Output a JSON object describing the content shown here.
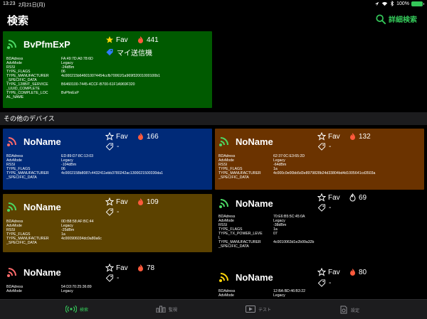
{
  "status": {
    "time": "13:23",
    "date": "2月21日(月)",
    "battery": "100%"
  },
  "nav": {
    "title": "検索",
    "detail": "詳細検索"
  },
  "colors": {
    "accent": "#34c759",
    "green_card": "#005a00",
    "blue_card": "#002a78",
    "brown_card": "#6b3300",
    "olive_card": "#5c4200"
  },
  "featured": {
    "name": "BvPfmExP",
    "fav_label": "Fav",
    "count": "441",
    "tag": "マイ送信機",
    "props": [
      {
        "k": "BDAdress",
        "v": "FA:49:7D:A0:78:6D"
      },
      {
        "k": "AdvMode",
        "v": "Legacy"
      },
      {
        "k": "RSSI",
        "v": "-24dBm"
      },
      {
        "k": "TYPE_FLAGS",
        "v": "06"
      },
      {
        "k": "TYPE_MANUFACTURER",
        "v": "4c000215b646010074454ccfb70061f1a969f32001000100b1"
      },
      {
        "k": "_SPECIFIC_DATA",
        "v": ""
      },
      {
        "k": "TYPE_128BIT_SERVICE",
        "v": "B6460100-7445-4CCF-B700-61F1A969F320"
      },
      {
        "k": "_UUID_COMPLETE",
        "v": ""
      },
      {
        "k": "TYPE_COMPLETE_LOC",
        "v": "BvPfmExP"
      },
      {
        "k": "AL_NAME",
        "v": ""
      }
    ]
  },
  "section_label": "その他のデバイス",
  "devices": [
    {
      "name": "NoName",
      "fav_label": "Fav",
      "count": "166",
      "tag": "-",
      "props": [
        {
          "k": "BDAdress",
          "v": "ED:89:D7:8C:13:03"
        },
        {
          "k": "AdvMode",
          "v": "Legacy"
        },
        {
          "k": "RSSI",
          "v": "-104dBm"
        },
        {
          "k": "TYPE_FLAGS",
          "v": "06"
        },
        {
          "k": "TYPE_MANUFACTURER",
          "v": "4c0002158b8087c4432411ebb3780242ac1300021500330da1"
        },
        {
          "k": "_SPECIFIC_DATA",
          "v": ""
        }
      ]
    },
    {
      "name": "NoName",
      "fav_label": "Fav",
      "count": "132",
      "tag": "-",
      "props": [
        {
          "k": "BDAdress",
          "v": "62:37:0C:E3:65:2D"
        },
        {
          "k": "AdvMode",
          "v": "Legacy"
        },
        {
          "k": "RSSI",
          "v": "-64dBm"
        },
        {
          "k": "TYPE_FLAGS",
          "v": "1a"
        },
        {
          "k": "TYPE_MANUFACTURER",
          "v": "4c000c0e00bb5d3e8979828b24d33804bd4d1005641cd3503a"
        },
        {
          "k": "_SPECIFIC_DATA",
          "v": ""
        }
      ]
    },
    {
      "name": "NoName",
      "fav_label": "Fav",
      "count": "109",
      "tag": "-",
      "props": [
        {
          "k": "BDAdress",
          "v": "0D:B8:58:AF:BC:44"
        },
        {
          "k": "AdvMode",
          "v": "Legacy"
        },
        {
          "k": "RSSI",
          "v": "-25dBm"
        },
        {
          "k": "TYPE_FLAGS",
          "v": "1a"
        },
        {
          "k": "TYPE_MANUFACTURER",
          "v": "4c000906034dc0a80a6c"
        },
        {
          "k": "_SPECIFIC_DATA",
          "v": ""
        }
      ]
    },
    {
      "name": "NoName",
      "fav_label": "Fav",
      "count": "69",
      "tag": "-",
      "props": [
        {
          "k": "BDAdress",
          "v": "70:E6:B5:5C:45:0A"
        },
        {
          "k": "AdvMode",
          "v": "Legacy"
        },
        {
          "k": "RSSI",
          "v": "-38dBm"
        },
        {
          "k": "TYPE_FLAGS",
          "v": "1a"
        },
        {
          "k": "TYPE_TX_POWER_LEVE",
          "v": "07"
        },
        {
          "k": "L",
          "v": ""
        },
        {
          "k": "TYPE_MANUFACTURER",
          "v": "4c0010063d1e2b99a32b"
        },
        {
          "k": "_SPECIFIC_DATA",
          "v": ""
        }
      ]
    },
    {
      "name": "NoName",
      "fav_label": "Fav",
      "count": "78",
      "tag": "-",
      "props": [
        {
          "k": "BDAdress",
          "v": "54:D3:70:25:36:89"
        },
        {
          "k": "AdvMode",
          "v": "Legacy"
        }
      ]
    },
    {
      "name": "NoName",
      "fav_label": "Fav",
      "count": "80",
      "tag": "-",
      "props": [
        {
          "k": "BDAdress",
          "v": "12:BA:BD:46:B3:22"
        },
        {
          "k": "AdvMode",
          "v": "Legacy"
        }
      ]
    }
  ],
  "tabs": [
    {
      "label": "検索",
      "icon": "broadcast-icon"
    },
    {
      "label": "監視",
      "icon": "chart-icon"
    },
    {
      "label": "テスト",
      "icon": "play-icon"
    },
    {
      "label": "設定",
      "icon": "settings-icon"
    }
  ]
}
